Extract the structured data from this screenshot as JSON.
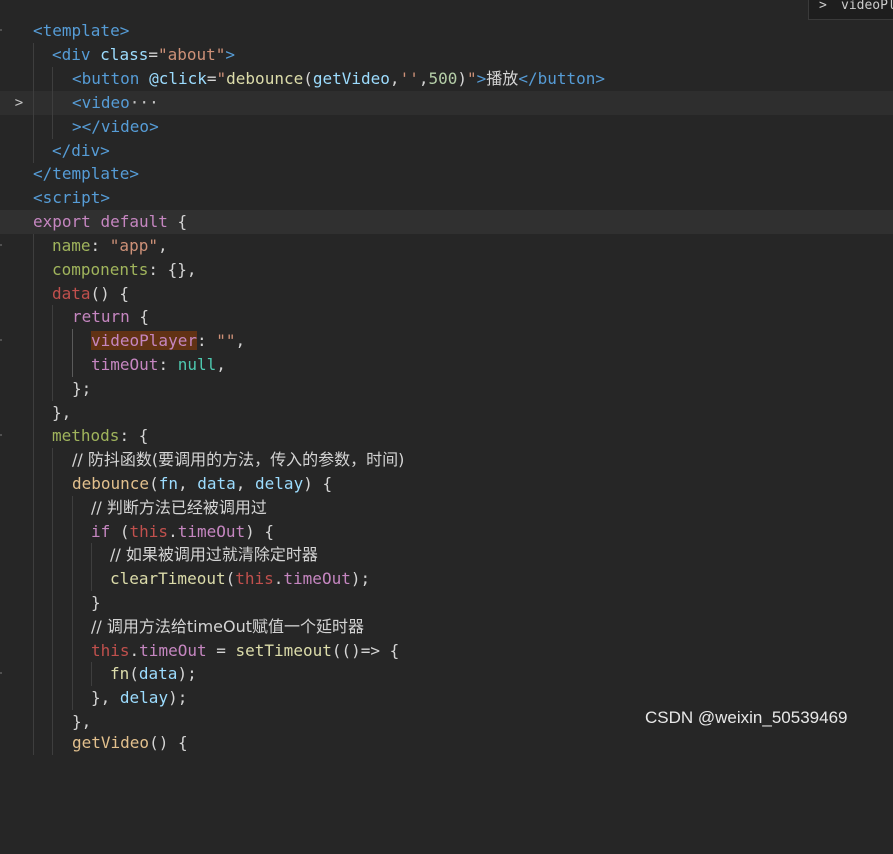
{
  "editor": {
    "peek_tab": {
      "chevron": ">",
      "label": "videoPl"
    },
    "fold_icon": "chevron-right-icon",
    "lines": {
      "l1": [
        "<template>"
      ],
      "l2": [
        "<div",
        " ",
        "class",
        "=",
        "\"about\"",
        ">"
      ],
      "l3": [
        "<button",
        " ",
        "@click",
        "=",
        "\"",
        "debounce",
        "(",
        "getVideo",
        ",",
        "''",
        ",",
        "500",
        ")",
        "\"",
        ">",
        "播放",
        "</button>"
      ],
      "l4": [
        "<video",
        "···"
      ],
      "l5": [
        "></video>"
      ],
      "l6": [
        "</div>"
      ],
      "l7": [
        "</template>"
      ],
      "l8": [
        "<script>"
      ],
      "l9": [
        "export",
        " ",
        "default",
        " {"
      ],
      "l10": [
        "name",
        ": ",
        "\"app\"",
        ","
      ],
      "l11": [
        "components",
        ": {},"
      ],
      "l12": [
        "data",
        "() {"
      ],
      "l13": [
        "return",
        " {"
      ],
      "l14": [
        "videoPlayer",
        ": ",
        "\"\"",
        ","
      ],
      "l15": [
        "timeOut",
        ": ",
        "null",
        ","
      ],
      "l16": [
        "};"
      ],
      "l17": [
        "},"
      ],
      "l18": [
        "methods",
        ": {"
      ],
      "l19": [
        "// 防抖函数(要调用的方法，传入的参数，时间)"
      ],
      "l20": [
        "debounce",
        "(",
        "fn",
        ", ",
        "data",
        ", ",
        "delay",
        ") {"
      ],
      "l21": [
        "// 判断方法已经被调用过"
      ],
      "l22": [
        "if",
        " (",
        "this",
        ".",
        "timeOut",
        ") {"
      ],
      "l23": [
        "// 如果被调用过就清除定时器"
      ],
      "l24": [
        "clearTimeout",
        "(",
        "this",
        ".",
        "timeOut",
        ");"
      ],
      "l25": [
        "}"
      ],
      "l26": [
        "// 调用方法给timeOut赋值一个延时器"
      ],
      "l27": [
        "this",
        ".",
        "timeOut",
        " = ",
        "setTimeout",
        "(()=> {"
      ],
      "l28": [
        "fn",
        "(",
        "data",
        ");"
      ],
      "l29": [
        "}, ",
        "delay",
        ");"
      ],
      "l30": [
        "},"
      ],
      "l31": [
        "getVideo",
        "() {"
      ]
    }
  },
  "watermark": "CSDN @weixin_50539469"
}
